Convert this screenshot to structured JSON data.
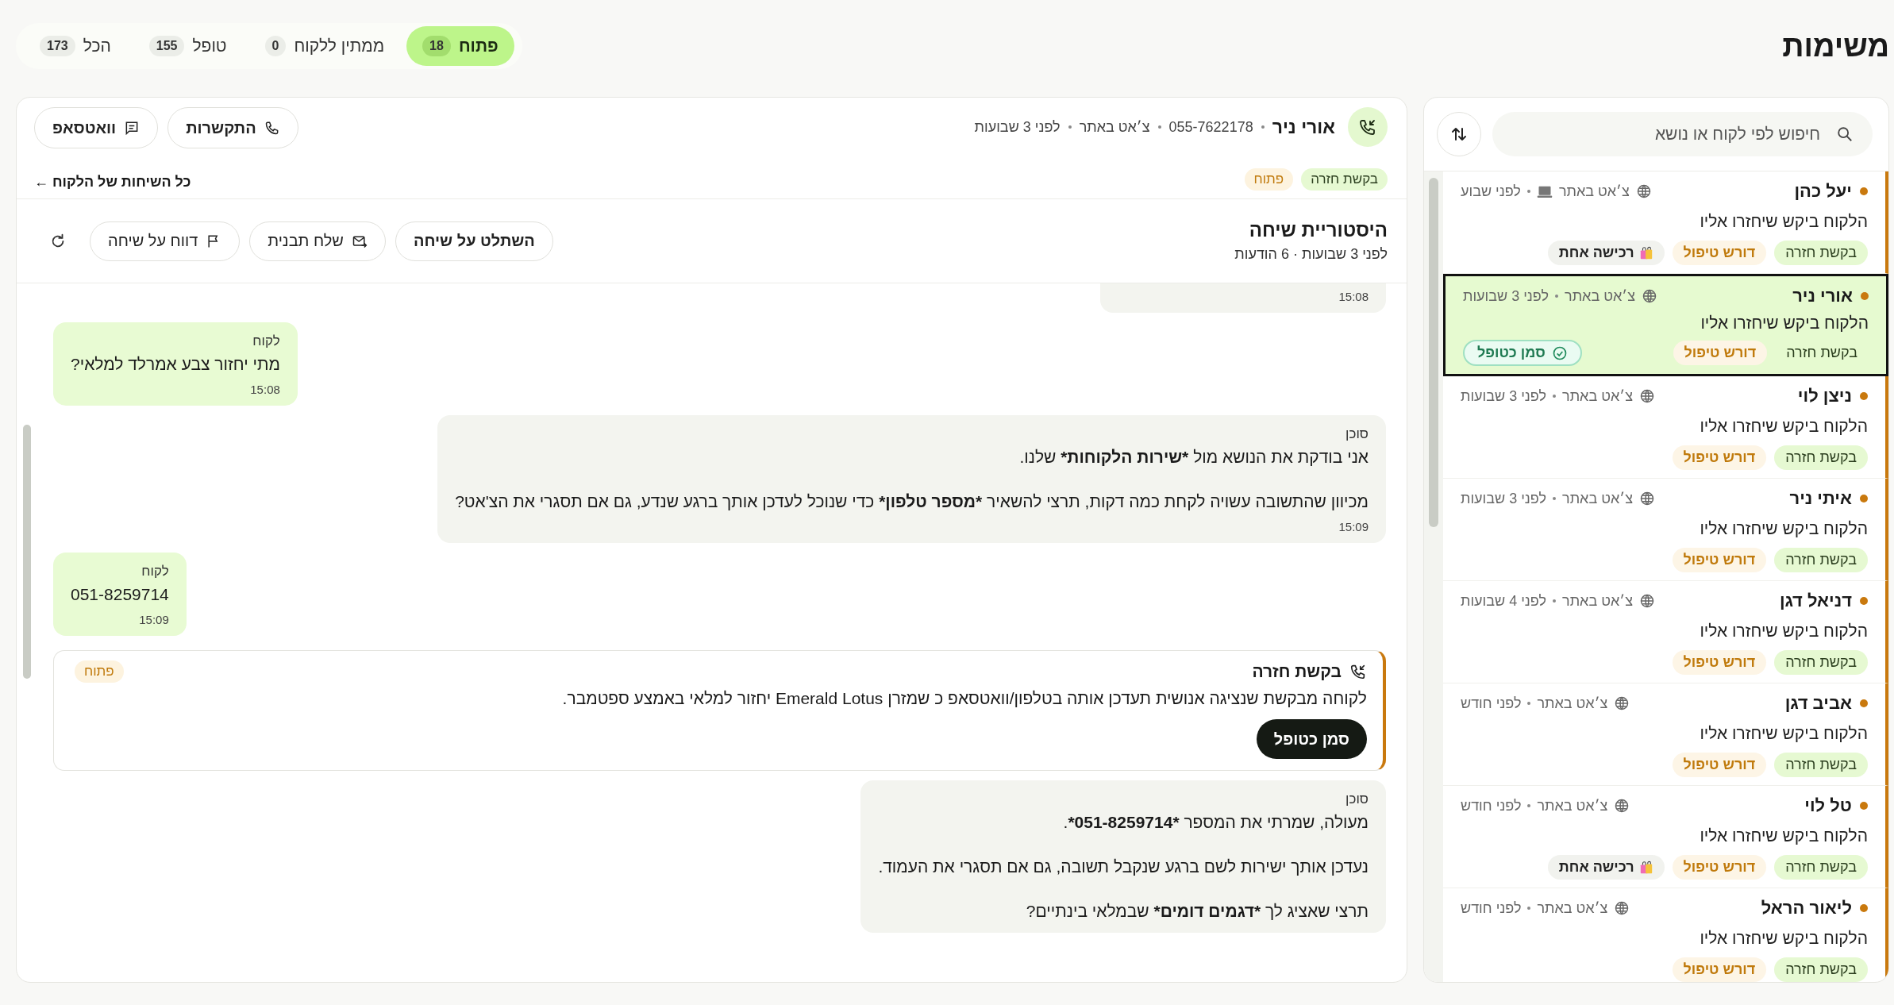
{
  "title": "משימות",
  "tabs": [
    {
      "label": "פתוח",
      "count": "18",
      "selected": true
    },
    {
      "label": "ממתין ללקוח",
      "count": "0",
      "selected": false
    },
    {
      "label": "טופל",
      "count": "155",
      "selected": false
    },
    {
      "label": "הכל",
      "count": "173",
      "selected": false
    }
  ],
  "list": {
    "search": {
      "placeholder": "חיפוש לפי לקוח או נושא"
    },
    "items": [
      {
        "name": "יעל כהן",
        "description": "הלקוח ביקש שיחזרו אליו",
        "channel": "צ׳אט באתר",
        "device_icon": true,
        "time": "לפני שבוע",
        "selected": false,
        "tags": [
          {
            "label": "בקשת חזרה",
            "kind": "status"
          },
          {
            "label": "דורש טיפול",
            "kind": "priority"
          },
          {
            "label": "רכישה אחת",
            "kind": "purchase"
          }
        ]
      },
      {
        "name": "אורי ניר",
        "description": "הלקוח ביקש שיחזרו אליו",
        "channel": "צ׳אט באתר",
        "device_icon": false,
        "time": "לפני 3 שבועות",
        "selected": true,
        "action": "סמן כטופל",
        "tags": [
          {
            "label": "בקשת חזרה",
            "kind": "status"
          },
          {
            "label": "דורש טיפול",
            "kind": "priority"
          }
        ]
      },
      {
        "name": "ניצן לוי",
        "description": "הלקוח ביקש שיחזרו אליו",
        "channel": "צ׳אט באתר",
        "device_icon": false,
        "time": "לפני 3 שבועות",
        "selected": false,
        "tags": [
          {
            "label": "בקשת חזרה",
            "kind": "status"
          },
          {
            "label": "דורש טיפול",
            "kind": "priority"
          }
        ]
      },
      {
        "name": "איתי ניר",
        "description": "הלקוח ביקש שיחזרו אליו",
        "channel": "צ׳אט באתר",
        "device_icon": false,
        "time": "לפני 3 שבועות",
        "selected": false,
        "tags": [
          {
            "label": "בקשת חזרה",
            "kind": "status"
          },
          {
            "label": "דורש טיפול",
            "kind": "priority"
          }
        ]
      },
      {
        "name": "דניאל דגן",
        "description": "הלקוח ביקש שיחזרו אליו",
        "channel": "צ׳אט באתר",
        "device_icon": false,
        "time": "לפני 4 שבועות",
        "selected": false,
        "tags": [
          {
            "label": "בקשת חזרה",
            "kind": "status"
          },
          {
            "label": "דורש טיפול",
            "kind": "priority"
          }
        ]
      },
      {
        "name": "אביב דגן",
        "description": "הלקוח ביקש שיחזרו אליו",
        "channel": "צ׳אט באתר",
        "device_icon": false,
        "time": "לפני חודש",
        "selected": false,
        "tags": [
          {
            "label": "בקשת חזרה",
            "kind": "status"
          },
          {
            "label": "דורש טיפול",
            "kind": "priority"
          }
        ]
      },
      {
        "name": "טל לוי",
        "description": "הלקוח ביקש שיחזרו אליו",
        "channel": "צ׳אט באתר",
        "device_icon": false,
        "time": "לפני חודש",
        "selected": false,
        "tags": [
          {
            "label": "בקשת חזרה",
            "kind": "status"
          },
          {
            "label": "דורש טיפול",
            "kind": "priority"
          },
          {
            "label": "רכישה אחת",
            "kind": "purchase"
          }
        ]
      },
      {
        "name": "ליאור הראל",
        "description": "הלקוח ביקש שיחזרו אליו",
        "channel": "צ׳אט באתר",
        "device_icon": false,
        "time": "לפני חודש",
        "selected": false,
        "tags": [
          {
            "label": "בקשת חזרה",
            "kind": "status"
          },
          {
            "label": "דורש טיפול",
            "kind": "priority"
          }
        ]
      }
    ]
  },
  "conversation": {
    "header": {
      "name": "אורי ניר",
      "phone": "055-7622178",
      "channel": "צ׳אט באתר",
      "time": "לפני 3 שבועות",
      "tags": [
        {
          "label": "בקשת חזרה",
          "kind": "status"
        },
        {
          "label": "פתוח",
          "kind": "state"
        }
      ],
      "buttons": [
        {
          "label": "התקשרות",
          "kind": "call"
        },
        {
          "label": "וואטסאפ",
          "kind": "whatsapp"
        }
      ],
      "link": "כל השיחות של הלקוח ←"
    },
    "history": {
      "title": "היסטוריית שיחה",
      "subtitle": "לפני 3 שבועות · 6 הודעות",
      "buttons": [
        {
          "label": "השתלט על שיחה",
          "kind": "takeover"
        },
        {
          "label": "שלח תבנית",
          "kind": "template"
        },
        {
          "label": "דווח על שיחה",
          "kind": "report"
        }
      ]
    },
    "messages": [
      {
        "kind": "agent",
        "time": "15:08"
      },
      {
        "kind": "customer",
        "sender": "לקוח",
        "paragraphs": [
          [
            {
              "text": "מתי יחזור צבע אמרלד למלאי?",
              "bold": false
            }
          ]
        ],
        "time": "15:08"
      },
      {
        "kind": "agent",
        "sender": "סוכן",
        "paragraphs": [
          [
            {
              "text": "אני בודקת את הנושא מול ",
              "bold": false
            },
            {
              "text": "*שירות הלקוחות*",
              "bold": true
            },
            {
              "text": " שלנו.",
              "bold": false
            }
          ],
          [
            {
              "text": "מכיוון שהתשובה עשויה לקחת כמה דקות, תרצי להשאיר ",
              "bold": false
            },
            {
              "text": "*מספר טלפון*",
              "bold": true
            },
            {
              "text": " כדי שנוכל לעדכן אותך ברגע שנדע, גם אם תסגרי את הצ'אט?",
              "bold": false
            }
          ]
        ],
        "time": "15:09"
      },
      {
        "kind": "customer",
        "sender": "לקוח",
        "paragraphs": [
          [
            {
              "text": "051-8259714",
              "bold": false
            }
          ]
        ],
        "time": "15:09"
      },
      {
        "kind": "request",
        "title": "בקשת חזרה",
        "text": "לקוחה מבקשת שנציגה אנושית תעדכן אותה בטלפון/וואטסאפ כ שמזרן Emerald Lotus יחזור למלאי באמצע ספטמבר.",
        "status": "פתוח",
        "action": "סמן כטופל"
      },
      {
        "kind": "agent",
        "sender": "סוכן",
        "paragraphs": [
          [
            {
              "text": "מעולה, שמרתי את המספר ",
              "bold": false
            },
            {
              "text": "*051-8259714*",
              "bold": true
            },
            {
              "text": ".",
              "bold": false
            }
          ],
          [
            {
              "text": "נעדכן אותך ישירות לשם ברגע שנקבל תשובה, גם אם תסגרי את העמוד.",
              "bold": false
            }
          ],
          [
            {
              "text": "תרצי שאציג לך ",
              "bold": false
            },
            {
              "text": "*דגמים דומים*",
              "bold": true
            },
            {
              "text": " שבמלאי בינתיים?",
              "bold": false
            }
          ]
        ]
      }
    ]
  }
}
